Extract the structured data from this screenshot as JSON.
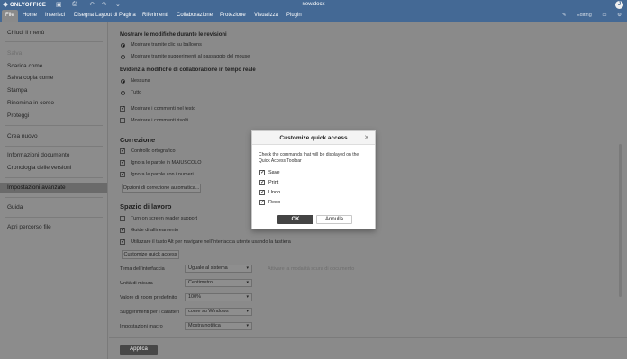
{
  "titlebar": {
    "app_name": "ONLYOFFICE",
    "doc_title": "new.docx",
    "avatar_initial": "J"
  },
  "menubar": {
    "tabs": [
      "File",
      "Home",
      "Inserisci",
      "Disegna",
      "Layout di Pagina",
      "Riferimenti",
      "Collaborazione",
      "Protezione",
      "Visualizza",
      "Plugin"
    ],
    "right_label": "Editing"
  },
  "sidebar": {
    "items": [
      "Chiudi il menù",
      "Salva",
      "Scarica come",
      "Salva copia come",
      "Stampa",
      "Rinomina in corso",
      "Proteggi",
      "Crea nuovo",
      "Informazioni documento",
      "Cronologia delle versioni",
      "Impostazioni avanzate",
      "Guida",
      "Apri percorso file"
    ]
  },
  "settings": {
    "track_changes_title": "Mostrare le modifiche durante le revisioni",
    "track_opt1": "Mostrare tramite clic su balloons",
    "track_opt2": "Mostrare tramite suggerimenti al passaggio del mouse",
    "highlight_title": "Evidenzia modifiche di collaborazione in tempo reale",
    "highlight_opt1": "Nessuna",
    "highlight_opt2": "Tutto",
    "comments_opt1": "Mostrare i commenti nel testo",
    "comments_opt2": "Mostrare i commenti risolti",
    "correction_title": "Correzione",
    "spell_check": "Controllo ortografico",
    "ignore_upper": "Ignora le parole in MAIUSCOLO",
    "ignore_numbers": "Ignora le parole con i numeri",
    "autocorrect_button": "Opzioni di correzione automatica...",
    "workspace_title": "Spazio di lavoro",
    "screen_reader": "Turn on screen reader support",
    "alignment_guides": "Guide di allineamento",
    "alt_key": "Utilizzare il tasto Alt per navigare nell'interfaccia utente usando la tastiera",
    "customize_button": "Customize quick access",
    "theme_label": "Tema dell'interfaccia",
    "theme_value": "Uguale al sistema",
    "theme_hint": "Attivare la modalità scura di documento",
    "unit_label": "Unità di misura",
    "unit_value": "Centimetro",
    "zoom_label": "Valore di zoom predefinito",
    "zoom_value": "100%",
    "font_hint_label": "Suggerimenti per i caratteri",
    "font_hint_value": "come su Windows",
    "macro_label": "Impostazioni macro",
    "macro_value": "Mostra notifica",
    "apply_button": "Applica"
  },
  "modal": {
    "title": "Customize quick access",
    "description": "Check the commands that will be displayed on the Quick Access Toolbar",
    "items": [
      {
        "label": "Save",
        "checked": true
      },
      {
        "label": "Print",
        "checked": true
      },
      {
        "label": "Undo",
        "checked": true
      },
      {
        "label": "Redo",
        "checked": true
      }
    ],
    "ok": "OK",
    "cancel": "Annulla"
  },
  "colors": {
    "header": "#446995",
    "overlay_bg": "#8a8a8a",
    "modal_bg": "#ffffff",
    "primary_button": "#444444"
  }
}
